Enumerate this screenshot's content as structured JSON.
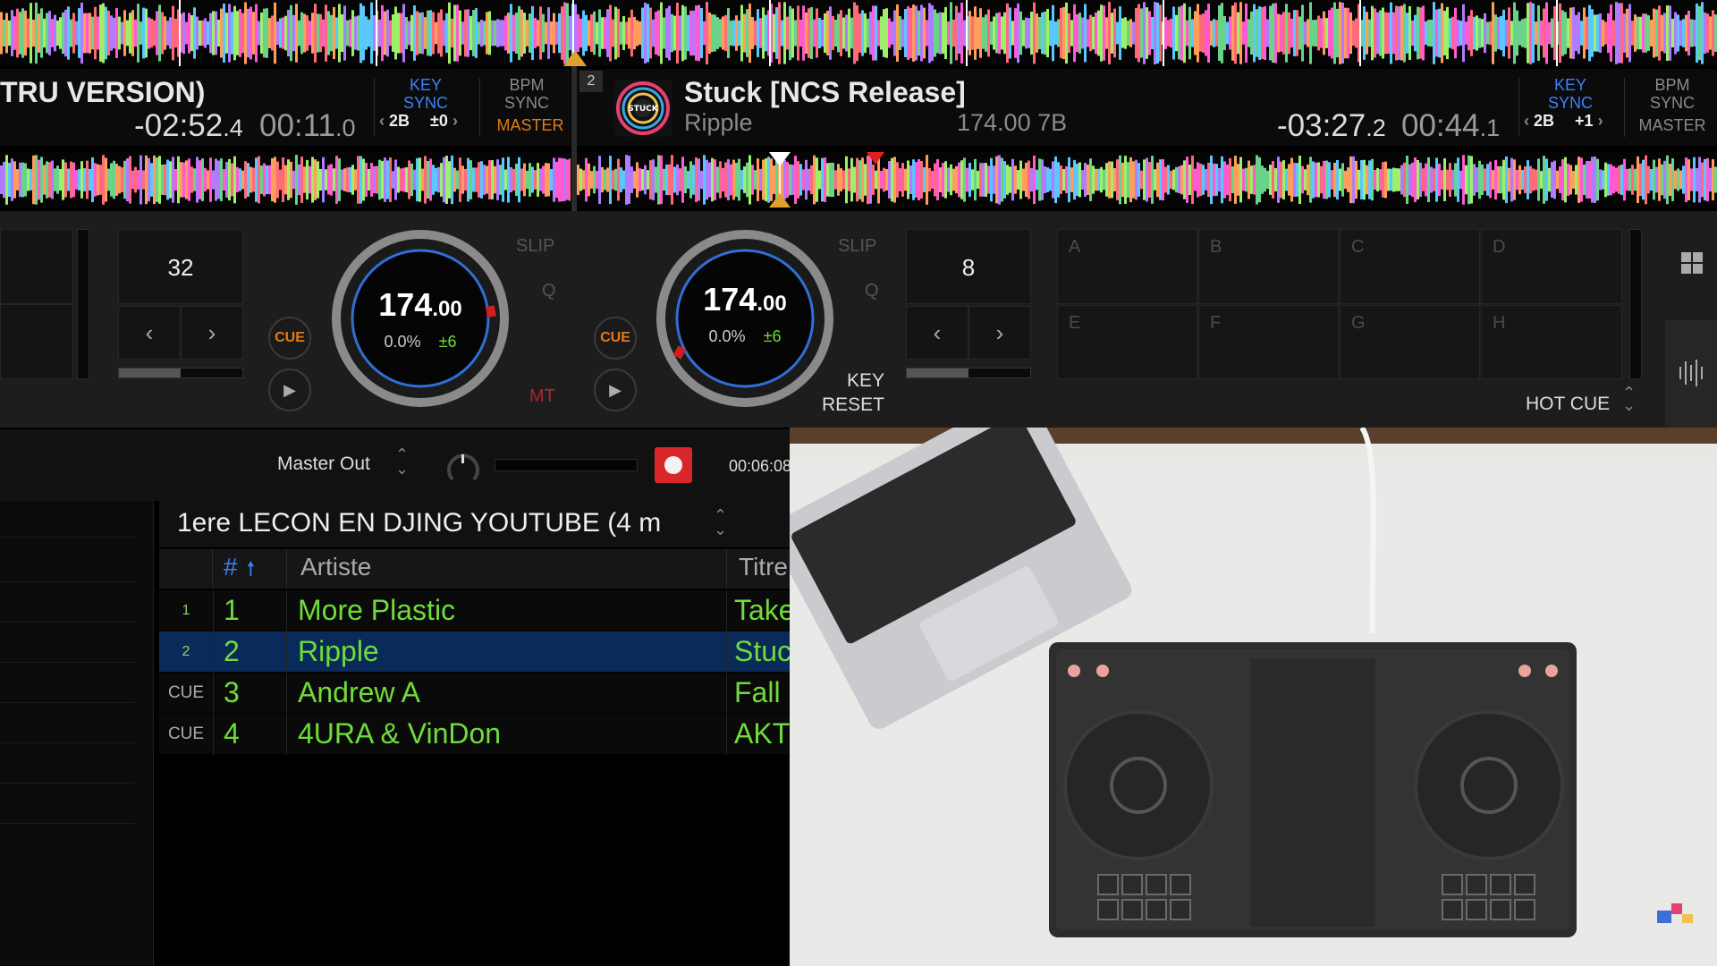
{
  "deck1": {
    "title_fragment": "TRU VERSION)",
    "time_remaining": "-02:52",
    "time_remaining_frac": ".4",
    "time_elapsed": "00:11",
    "time_elapsed_frac": ".0",
    "key_sync_label": "KEY",
    "sync_label": "SYNC",
    "key_value": "2B",
    "key_offset": "±0",
    "bpm_label": "BPM",
    "bpm_sync_label": "SYNC",
    "master_label": "MASTER",
    "beat_jump": "32",
    "bpm_int": "174",
    "bpm_frac": ".00",
    "pitch": "0.0%",
    "pitch_range": "±6",
    "cue_label": "CUE",
    "slip_label": "SLIP",
    "q_label": "Q",
    "mt_label": "MT"
  },
  "deck2": {
    "deck_number": "2",
    "title": "Stuck [NCS Release]",
    "artist": "Ripple",
    "bpm_key": "174.00 7B",
    "time_remaining": "-03:27",
    "time_remaining_frac": ".2",
    "time_elapsed": "00:44",
    "time_elapsed_frac": ".1",
    "key_sync_label": "KEY",
    "sync_label": "SYNC",
    "key_value": "2B",
    "key_offset": "+1",
    "bpm_label": "BPM",
    "bpm_sync_label": "SYNC",
    "master_label": "MASTER",
    "beat_jump": "8",
    "bpm_int": "174",
    "bpm_frac": ".00",
    "pitch": "0.0%",
    "pitch_range": "±6",
    "cue_label": "CUE",
    "slip_label": "SLIP",
    "q_label": "Q",
    "key_reset_line1": "KEY",
    "key_reset_line2": "RESET",
    "art_text": "STUCK"
  },
  "hotcues": {
    "pads": [
      "A",
      "B",
      "C",
      "D",
      "E",
      "F",
      "G",
      "H"
    ],
    "mode_label": "HOT CUE"
  },
  "recorder": {
    "output_label": "Master Out",
    "rec_time": "00:06:08"
  },
  "library": {
    "playlist_name": "1ere LECON EN DJING YOUTUBE (4 m",
    "columns": {
      "number": "#",
      "artist": "Artiste",
      "title": "Titre"
    },
    "rows": [
      {
        "deck": "1",
        "num": "1",
        "artist": "More Plastic",
        "title": "Take"
      },
      {
        "deck": "2",
        "num": "2",
        "artist": "Ripple",
        "title": "Stuc"
      },
      {
        "deck": "CUE",
        "num": "3",
        "artist": "Andrew A",
        "title": "Fall"
      },
      {
        "deck": "CUE",
        "num": "4",
        "artist": "4URA & VinDon",
        "title": "AKT"
      }
    ]
  },
  "colors": {
    "accent_blue": "#3b82f6",
    "cue_orange": "#e07b1a",
    "track_green": "#6fdc3a",
    "selected_row": "#0a2a5a",
    "rec_red": "#d9262b"
  }
}
